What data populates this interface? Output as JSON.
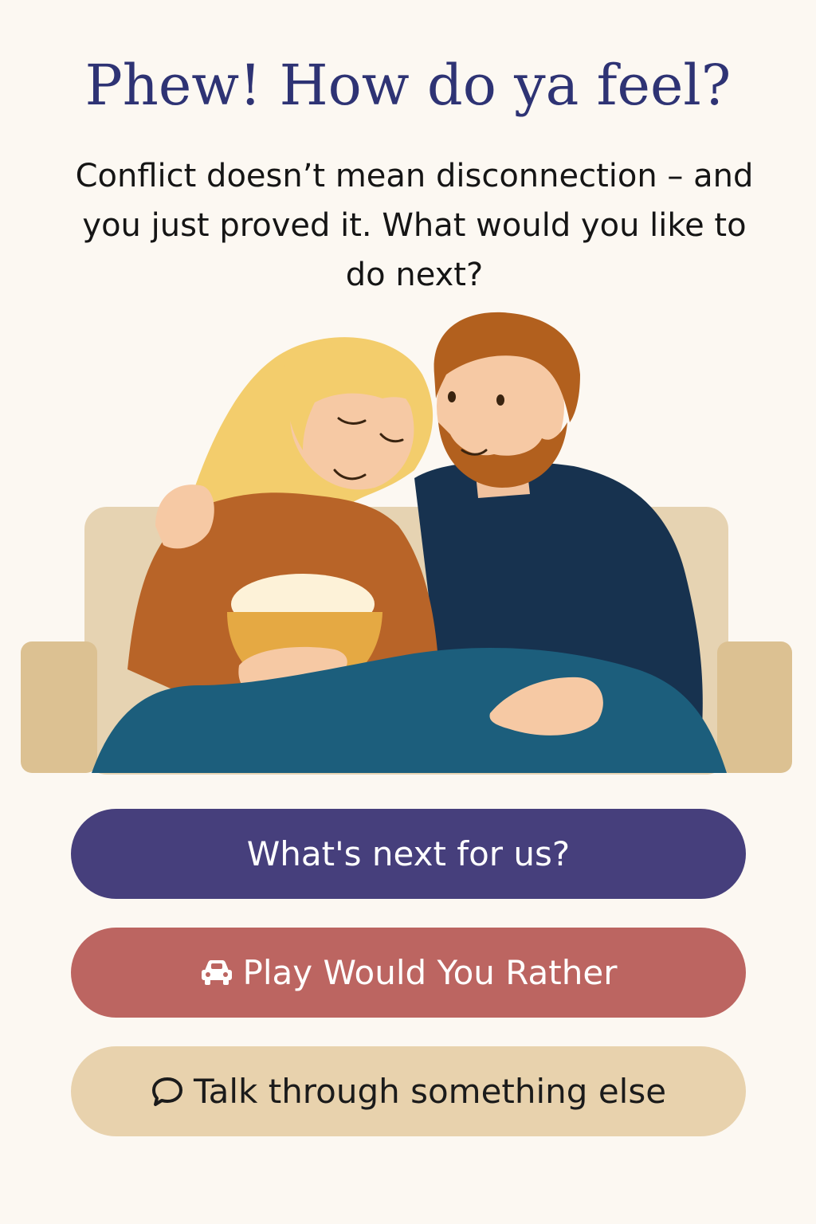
{
  "header": {
    "title": "Phew! How do ya feel?",
    "subtitle": "Conflict doesn’t mean disconnection – and you just proved it. What would you like to do next?"
  },
  "illustration": {
    "description_icon": "couple-on-couch-illustration"
  },
  "actions": {
    "next_label": "What's next for us?",
    "play_label": "Play Would You Rather",
    "play_icon": "car-icon",
    "talk_label": "Talk through something else",
    "talk_icon": "speech-bubble-icon"
  },
  "colors": {
    "background": "#fcf8f2",
    "title": "#2e3374",
    "next_button": "#463f7c",
    "play_button": "#bc6561",
    "talk_button": "#e8d2ad"
  }
}
